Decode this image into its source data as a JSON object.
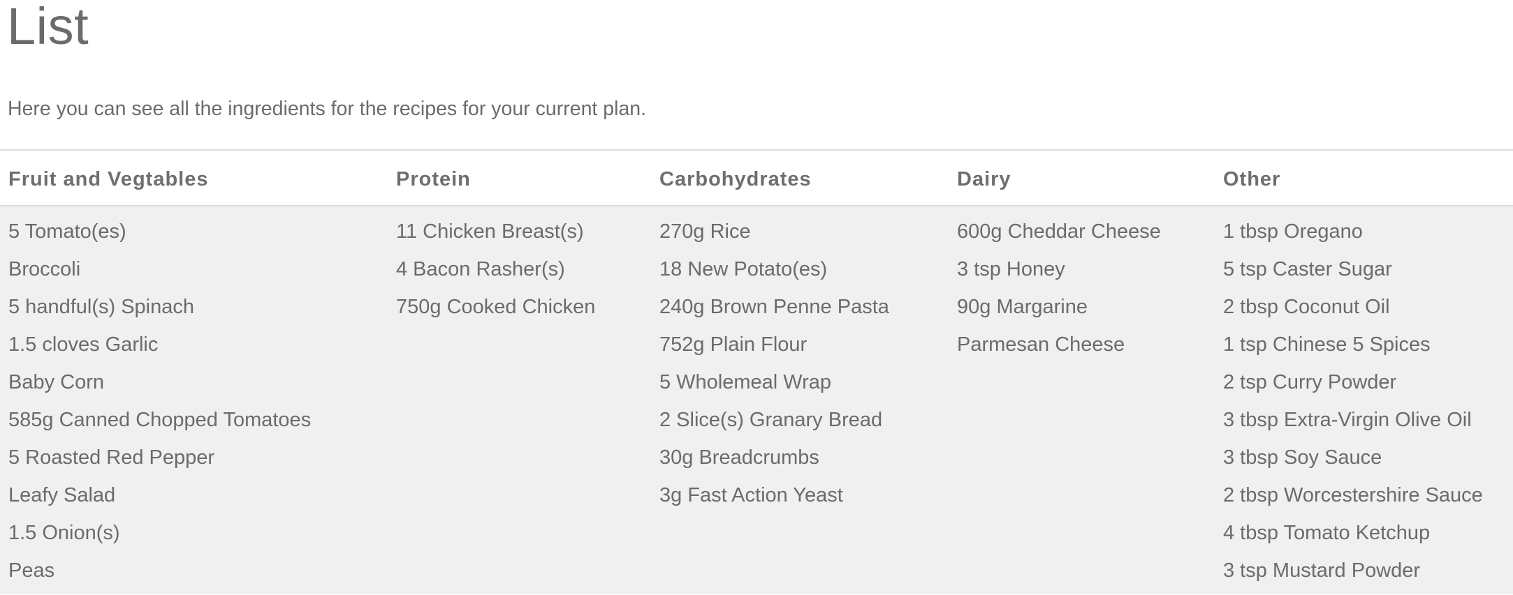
{
  "page": {
    "title": "List",
    "intro": "Here you can see all the ingredients for the recipes for your current plan."
  },
  "columns": [
    {
      "heading": "Fruit and Vegtables",
      "items": [
        "5 Tomato(es)",
        "Broccoli",
        "5 handful(s) Spinach",
        "1.5 cloves Garlic",
        "Baby Corn",
        "585g Canned Chopped Tomatoes",
        "5 Roasted Red Pepper",
        "Leafy Salad",
        "1.5 Onion(s)",
        "Peas"
      ]
    },
    {
      "heading": "Protein",
      "items": [
        "11 Chicken Breast(s)",
        "4 Bacon Rasher(s)",
        "750g Cooked Chicken"
      ]
    },
    {
      "heading": "Carbohydrates",
      "items": [
        "270g Rice",
        "18 New Potato(es)",
        "240g Brown Penne Pasta",
        "752g Plain Flour",
        "5 Wholemeal Wrap",
        "2 Slice(s) Granary Bread",
        "30g Breadcrumbs",
        "3g Fast Action Yeast"
      ]
    },
    {
      "heading": "Dairy",
      "items": [
        "600g Cheddar Cheese",
        "3 tsp Honey",
        "90g Margarine",
        "Parmesan Cheese"
      ]
    },
    {
      "heading": "Other",
      "items": [
        "1 tbsp Oregano",
        "5 tsp Caster Sugar",
        "2 tbsp Coconut Oil",
        "1 tsp Chinese 5 Spices",
        "2 tsp Curry Powder",
        "3 tbsp Extra-Virgin Olive Oil",
        "3 tbsp Soy Sauce",
        "2 tbsp Worcestershire Sauce",
        "4 tbsp Tomato Ketchup",
        "3 tsp Mustard Powder"
      ]
    }
  ]
}
